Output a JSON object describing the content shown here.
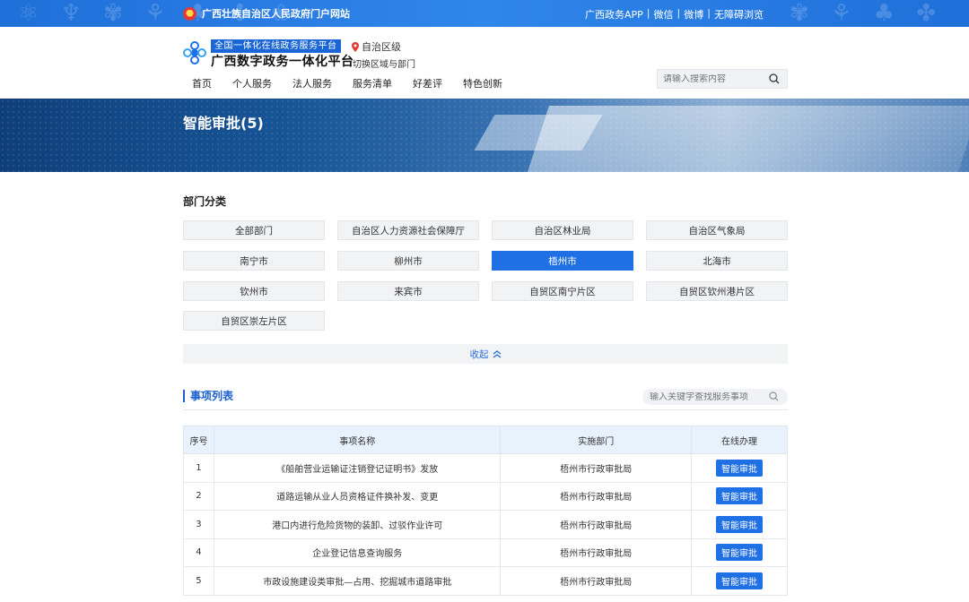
{
  "gov_bar": {
    "site_name": "广西壮族自治区人民政府门户网站",
    "links": [
      "广西政务APP",
      "微信",
      "微博",
      "无障碍浏览"
    ]
  },
  "header": {
    "slogan": "全国一体化在线政务服务平台",
    "platform_name": "广西数字政务一体化平台",
    "region": "自治区级",
    "switch_region": "切换区域与部门",
    "nav": [
      "首页",
      "个人服务",
      "法人服务",
      "服务清单",
      "好差评",
      "特色创新"
    ],
    "search_placeholder": "请输入搜索内容"
  },
  "banner": {
    "title": "智能审批(5)"
  },
  "departments": {
    "title": "部门分类",
    "items": [
      "全部部门",
      "自治区人力资源社会保障厅",
      "自治区林业局",
      "自治区气象局",
      "南宁市",
      "柳州市",
      "梧州市",
      "北海市",
      "钦州市",
      "来宾市",
      "自贸区南宁片区",
      "自贸区钦州港片区",
      "自贸区崇左片区"
    ],
    "active": "梧州市",
    "collapse_label": "收起"
  },
  "list": {
    "title": "事项列表",
    "search_placeholder": "输入关键字查找服务事项",
    "columns": [
      "序号",
      "事项名称",
      "实施部门",
      "在线办理"
    ],
    "rows": [
      {
        "no": "1",
        "name": "《船舶营业运输证注销登记证明书》发放",
        "dept": "梧州市行政审批局",
        "action": "智能审批"
      },
      {
        "no": "2",
        "name": "道路运输从业人员资格证件换补发、变更",
        "dept": "梧州市行政审批局",
        "action": "智能审批"
      },
      {
        "no": "3",
        "name": "港口内进行危险货物的装卸、过驳作业许可",
        "dept": "梧州市行政审批局",
        "action": "智能审批"
      },
      {
        "no": "4",
        "name": "企业登记信息查询服务",
        "dept": "梧州市行政审批局",
        "action": "智能审批"
      },
      {
        "no": "5",
        "name": "市政设施建设类审批—占用、挖掘城市道路审批",
        "dept": "梧州市行政审批局",
        "action": "智能审批"
      }
    ]
  },
  "colors": {
    "primary": "#1f6fe5",
    "gov_bar": "#2f86ea",
    "header_cell": "#e8f2fc"
  },
  "icons": [
    "emblem-icon",
    "logo-icon",
    "location-pin-icon",
    "search-icon",
    "chevron-up-icon"
  ]
}
